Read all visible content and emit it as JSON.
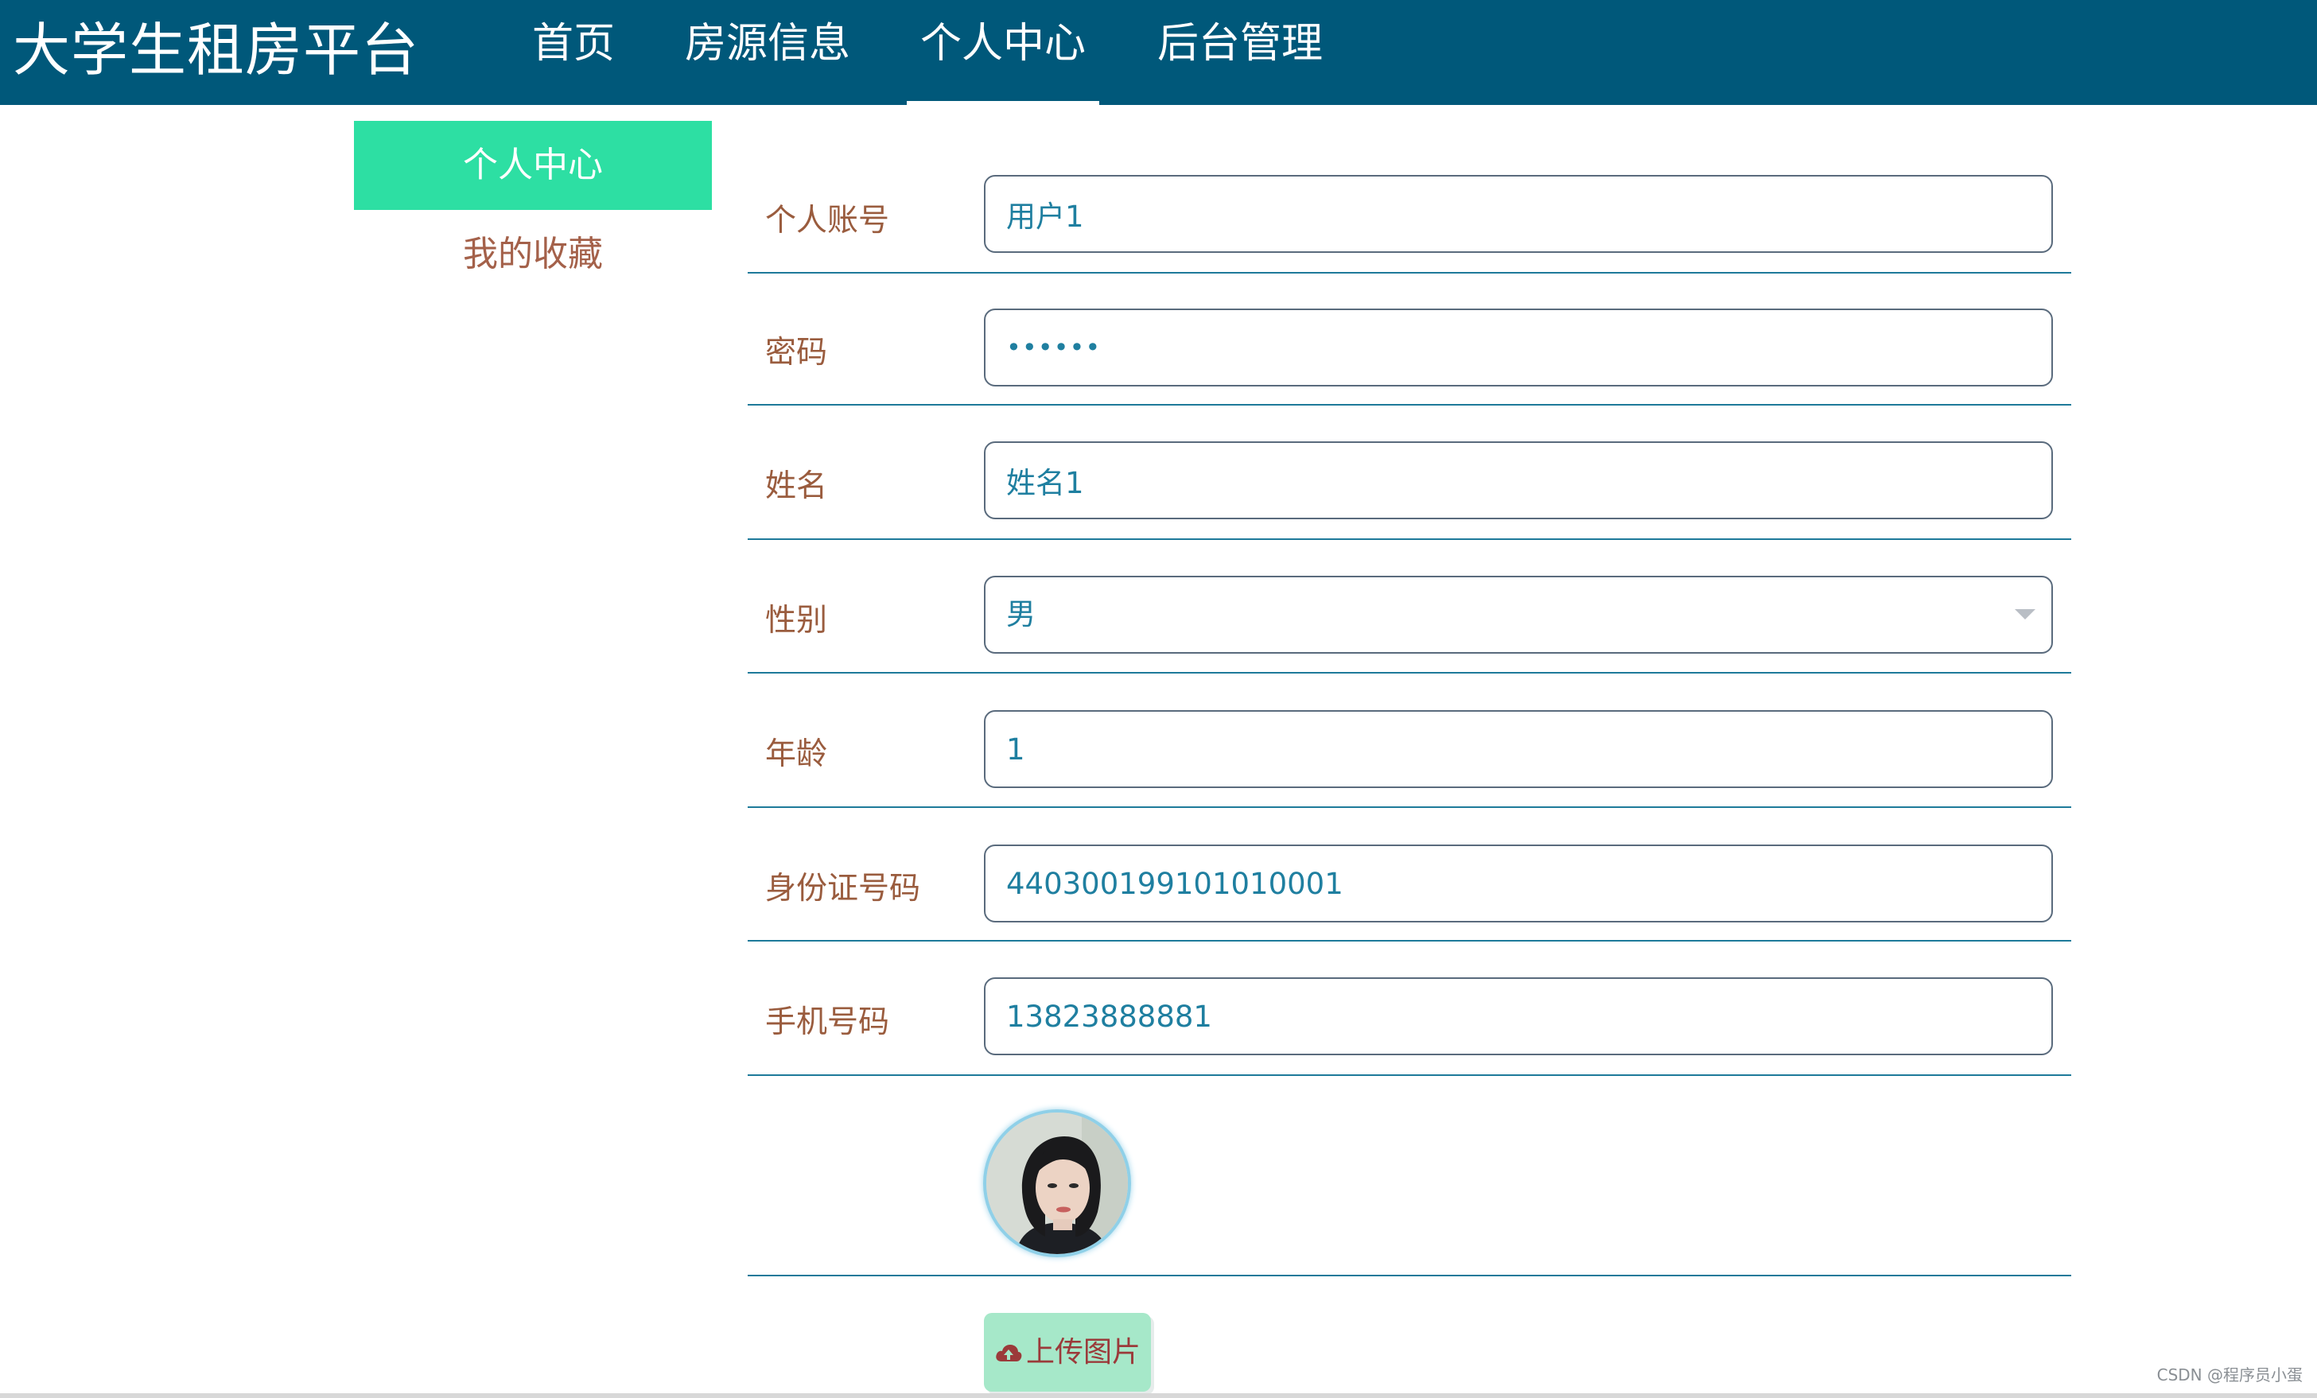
{
  "header": {
    "brand": "大学生租房平台",
    "nav": [
      {
        "label": "首页",
        "active": false
      },
      {
        "label": "房源信息",
        "active": false
      },
      {
        "label": "个人中心",
        "active": true
      },
      {
        "label": "后台管理",
        "active": false
      }
    ],
    "bg_color": "#00587a"
  },
  "sidebar": {
    "active_item": "个人中心",
    "items": [
      {
        "label": "个人中心"
      },
      {
        "label": "我的收藏"
      }
    ],
    "active_color": "#2ddfa3"
  },
  "form": {
    "account": {
      "label": "个人账号",
      "value": "用户1"
    },
    "password": {
      "label": "密码",
      "value": "••••••"
    },
    "name": {
      "label": "姓名",
      "value": "姓名1"
    },
    "gender": {
      "label": "性别",
      "value": "男"
    },
    "age": {
      "label": "年龄",
      "value": "1"
    },
    "id_number": {
      "label": "身份证号码",
      "value": "440300199101010001"
    },
    "phone": {
      "label": "手机号码",
      "value": "13823888881"
    },
    "upload_label": "上传图片"
  },
  "watermark": "CSDN @程序员小蛋"
}
